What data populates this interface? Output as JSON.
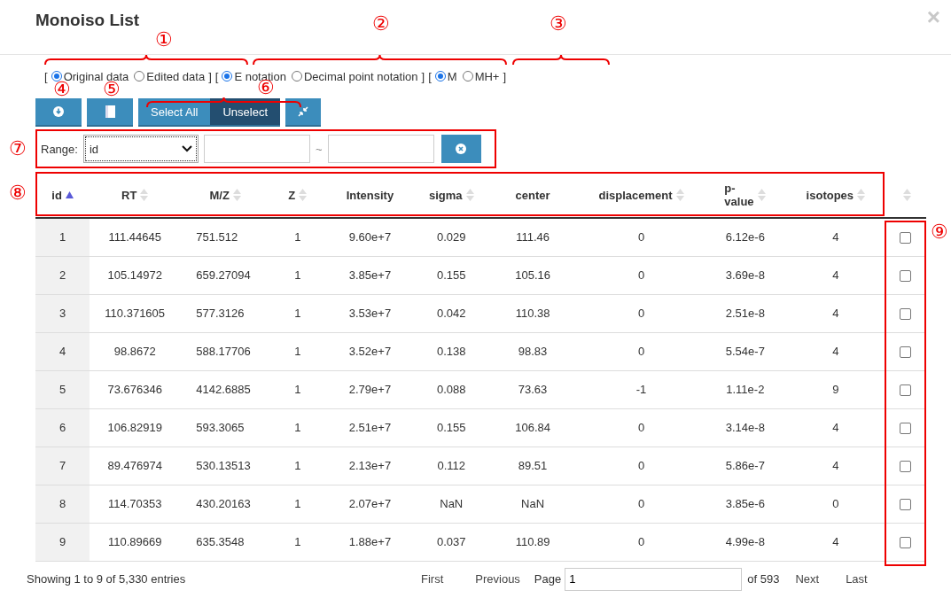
{
  "dialog": {
    "title": "Monoiso List",
    "close": "×"
  },
  "radio_groups": [
    {
      "open": "[",
      "close": "]",
      "options": [
        {
          "label": "Original data",
          "selected": true
        },
        {
          "label": "Edited data",
          "selected": false
        }
      ]
    },
    {
      "open": "[",
      "close": "]",
      "options": [
        {
          "label": "E notation",
          "selected": true
        },
        {
          "label": "Decimal point notation",
          "selected": false
        }
      ]
    },
    {
      "open": "[",
      "close": "]",
      "options": [
        {
          "label": "M",
          "selected": true
        },
        {
          "label": "MH+",
          "selected": false
        }
      ]
    }
  ],
  "toolbar": [
    {
      "kind": "download"
    },
    {
      "kind": "copy"
    },
    {
      "kind": "text",
      "label": "Select All",
      "selected": false
    },
    {
      "kind": "text",
      "label": "Unselect",
      "selected": true
    },
    {
      "kind": "compress"
    }
  ],
  "range": {
    "label": "Range:",
    "field": "id",
    "separator": "~"
  },
  "table": {
    "columns": [
      {
        "label": "id",
        "sortable": true,
        "sorted": true
      },
      {
        "label": "RT",
        "sortable": true,
        "sorted": false
      },
      {
        "label": "M/Z",
        "sortable": true,
        "sorted": false
      },
      {
        "label": "Z",
        "sortable": true,
        "sorted": false
      },
      {
        "label": "Intensity",
        "sortable": false
      },
      {
        "label": "sigma",
        "sortable": true,
        "sorted": false
      },
      {
        "label": "center",
        "sortable": false
      },
      {
        "label": "displacement",
        "sortable": true,
        "sorted": false
      },
      {
        "label": "p-value",
        "sortable": true,
        "sorted": false
      },
      {
        "label": "isotopes",
        "sortable": true,
        "sorted": false
      },
      {
        "sortable": true,
        "sorted": false
      }
    ],
    "rows": [
      {
        "cells": [
          "1",
          "111.44645",
          "751.512",
          "1",
          "9.60e+7",
          "0.029",
          "111.46",
          "0",
          "6.12e-6",
          "4"
        ],
        "checked": false
      },
      {
        "cells": [
          "2",
          "105.14972",
          "659.27094",
          "1",
          "3.85e+7",
          "0.155",
          "105.16",
          "0",
          "3.69e-8",
          "4"
        ],
        "checked": false
      },
      {
        "cells": [
          "3",
          "110.371605",
          "577.3126",
          "1",
          "3.53e+7",
          "0.042",
          "110.38",
          "0",
          "2.51e-8",
          "4"
        ],
        "checked": false
      },
      {
        "cells": [
          "4",
          "98.8672",
          "588.17706",
          "1",
          "3.52e+7",
          "0.138",
          "98.83",
          "0",
          "5.54e-7",
          "4"
        ],
        "checked": false
      },
      {
        "cells": [
          "5",
          "73.676346",
          "4142.6885",
          "1",
          "2.79e+7",
          "0.088",
          "73.63",
          "-1",
          "1.11e-2",
          "9"
        ],
        "checked": false
      },
      {
        "cells": [
          "6",
          "106.82919",
          "593.3065",
          "1",
          "2.51e+7",
          "0.155",
          "106.84",
          "0",
          "3.14e-8",
          "4"
        ],
        "checked": false
      },
      {
        "cells": [
          "7",
          "89.476974",
          "530.13513",
          "1",
          "2.13e+7",
          "0.112",
          "89.51",
          "0",
          "5.86e-7",
          "4"
        ],
        "checked": false
      },
      {
        "cells": [
          "8",
          "114.70353",
          "430.20163",
          "1",
          "2.07e+7",
          "NaN",
          "NaN",
          "0",
          "3.85e-6",
          "0"
        ],
        "checked": false
      },
      {
        "cells": [
          "9",
          "110.89669",
          "635.3548",
          "1",
          "1.88e+7",
          "0.037",
          "110.89",
          "0",
          "4.99e-8",
          "4"
        ],
        "checked": false
      }
    ]
  },
  "footer": {
    "info": "Showing 1 to 9 of 5,330 entries",
    "first": "First",
    "previous": "Previous",
    "page_label": "Page",
    "page": "1",
    "of": "of 593",
    "next": "Next",
    "last": "Last"
  },
  "callouts": [
    {
      "label": "①",
      "kind": "brace"
    },
    {
      "label": "②",
      "kind": "brace"
    },
    {
      "label": "③",
      "kind": "brace"
    },
    {
      "label": "④",
      "kind": "plain"
    },
    {
      "label": "⑤",
      "kind": "plain"
    },
    {
      "label": "⑥",
      "kind": "brace"
    },
    {
      "label": "⑦",
      "kind": "box"
    },
    {
      "label": "⑧",
      "kind": "box"
    },
    {
      "label": "⑨",
      "kind": "box"
    }
  ]
}
